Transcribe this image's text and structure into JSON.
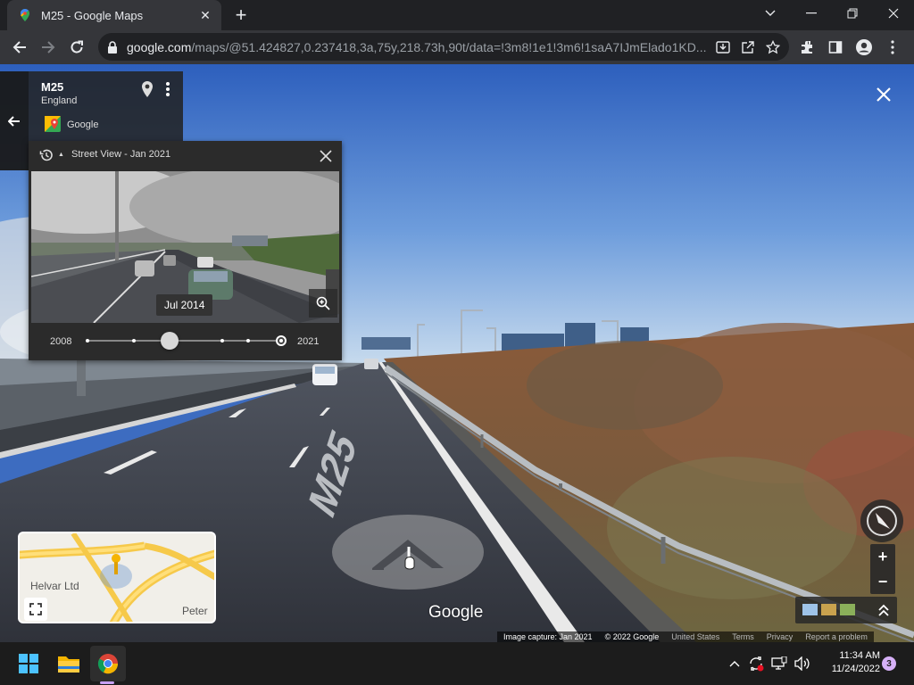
{
  "browser": {
    "tab_title": "M25 - Google Maps",
    "url_host": "google.com",
    "url_path": "/maps/@51.424827,0.237418,3a,75y,218.73h,90t/data=!3m8!1e1!3m6!1saA7IJmElado1KD..."
  },
  "infocard": {
    "road": "M25",
    "region": "England",
    "source": "Google"
  },
  "timepanel": {
    "label": "Street View - Jan 2021",
    "selected_date": "Jul 2014",
    "start_year": "2008",
    "end_year": "2021"
  },
  "minimap": {
    "poi_1": "Helvar Ltd",
    "poi_2": "Peter"
  },
  "logo": "Google",
  "footer": {
    "capture": "Image capture: Jan 2021",
    "copyright": "© 2022 Google",
    "region": "United States",
    "terms": "Terms",
    "privacy": "Privacy",
    "report": "Report a problem"
  },
  "taskbar": {
    "time": "11:34 AM",
    "date": "11/24/2022",
    "notifications": "3"
  },
  "colors": {
    "chrome_dark": "#202124",
    "chrome_toolbar": "#35363a",
    "sky": "#3d6cc0",
    "road": "#3c3f47",
    "taskbar": "#1c1c1c"
  }
}
